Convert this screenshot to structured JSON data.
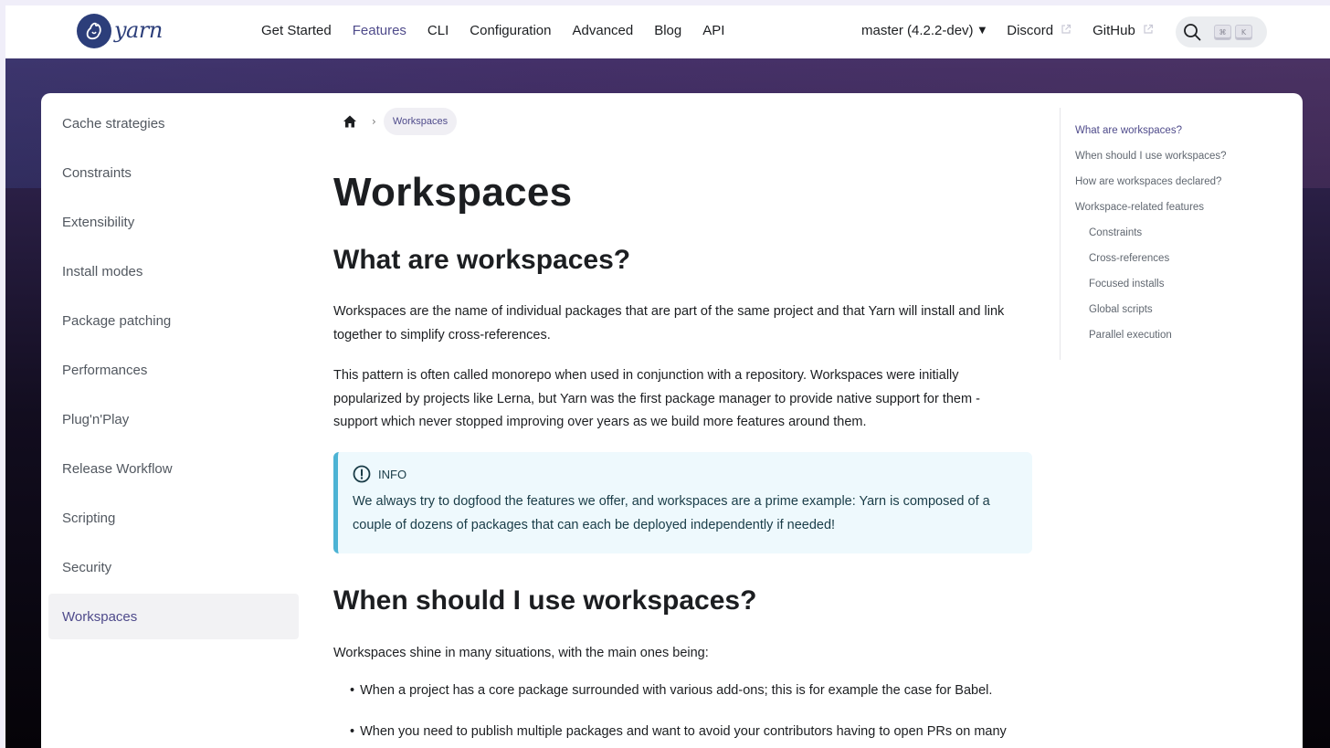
{
  "logo": {
    "text": "yarn"
  },
  "navbar": {
    "links": [
      {
        "label": "Get Started"
      },
      {
        "label": "Features"
      },
      {
        "label": "CLI"
      },
      {
        "label": "Configuration"
      },
      {
        "label": "Advanced"
      },
      {
        "label": "Blog"
      },
      {
        "label": "API"
      }
    ],
    "active_link": "Features",
    "version_label": "master (4.2.2-dev)",
    "discord_label": "Discord",
    "github_label": "GitHub",
    "search_keys": [
      "⌘",
      "K"
    ]
  },
  "sidebar": {
    "items": [
      {
        "label": "Cache strategies"
      },
      {
        "label": "Constraints"
      },
      {
        "label": "Extensibility"
      },
      {
        "label": "Install modes"
      },
      {
        "label": "Package patching"
      },
      {
        "label": "Performances"
      },
      {
        "label": "Plug'n'Play"
      },
      {
        "label": "Release Workflow"
      },
      {
        "label": "Scripting"
      },
      {
        "label": "Security"
      },
      {
        "label": "Workspaces"
      }
    ],
    "active_item": "Workspaces"
  },
  "breadcrumb": {
    "current": "Workspaces"
  },
  "article": {
    "title": "Workspaces",
    "section1_heading": "What are workspaces?",
    "section1_p1_l1": "Workspaces are the name of individual packages that are part of the same project and that Yarn will install and link",
    "section1_p1_l2": "together to simplify cross-references.",
    "section1_p2_l1": "This pattern is often called monorepo when used in conjunction with a repository. Workspaces were initially",
    "section1_p2_l2": "popularized by projects like Lerna, but Yarn was the first package manager to provide native support for them -",
    "section1_p2_l3": "support which never stopped improving over years as we build more features around them.",
    "info_label": "INFO",
    "info_l1": "We always try to dogfood the features we offer, and workspaces are a prime example: Yarn is composed of a",
    "info_l2": "couple of dozens of packages that can each be deployed independently if needed!",
    "section2_heading": "When should I use workspaces?",
    "section2_intro": "Workspaces shine in many situations, with the main ones being:",
    "bullets": [
      "When a project has a core package surrounded with various add-ons; this is for example the case for Babel.",
      "When you need to publish multiple packages and want to avoid your contributors having to open PRs on many"
    ]
  },
  "toc": {
    "items": [
      {
        "label": "What are workspaces?"
      },
      {
        "label": "When should I use workspaces?"
      },
      {
        "label": "How are workspaces declared?"
      },
      {
        "label": "Workspace-related features"
      },
      {
        "label": "Constraints"
      },
      {
        "label": "Cross-references"
      },
      {
        "label": "Focused installs"
      },
      {
        "label": "Global scripts"
      },
      {
        "label": "Parallel execution"
      }
    ],
    "active_item": "What are workspaces?"
  },
  "colors": {
    "accent": "#4f4b8b",
    "brand": "#2c3e7a",
    "info_border": "#4cb3d4",
    "info_bg": "#eef9fd"
  }
}
